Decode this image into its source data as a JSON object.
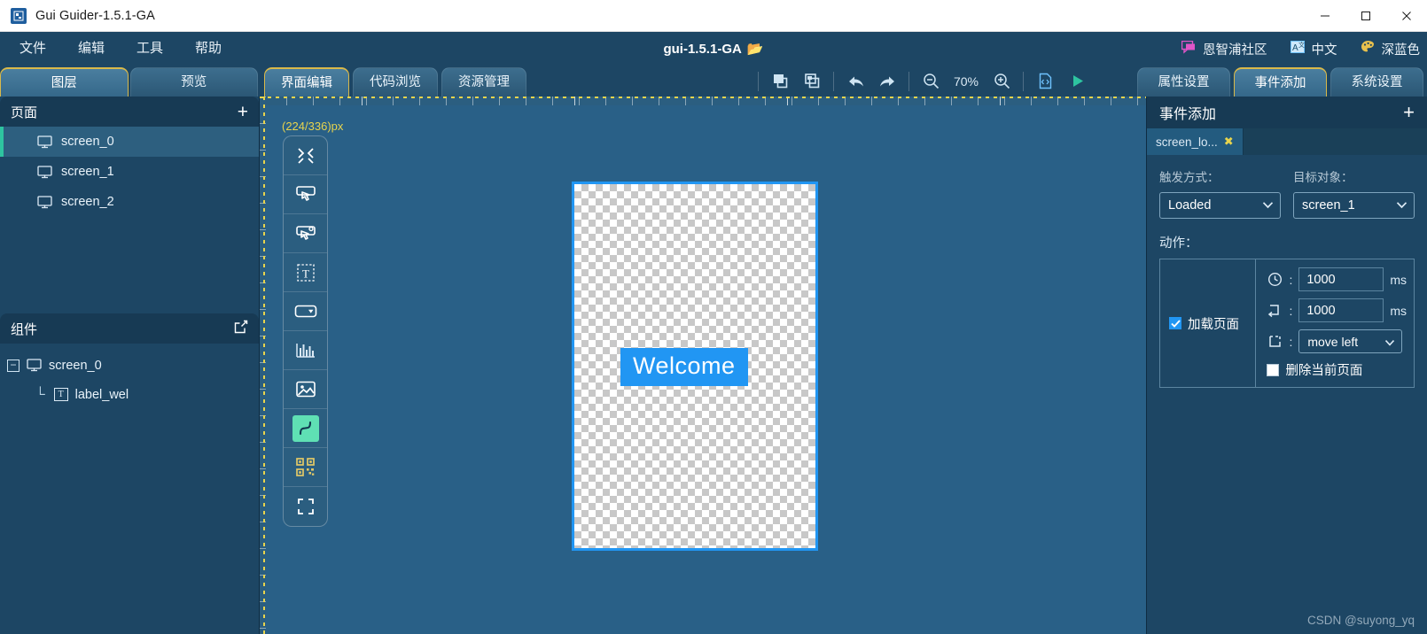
{
  "window": {
    "title": "Gui Guider-1.5.1-GA",
    "app_icon": "app-icon",
    "minimize": "minimize-icon",
    "maximize": "maximize-icon",
    "close": "close-icon"
  },
  "menubar": {
    "items": [
      {
        "label": "文件"
      },
      {
        "label": "编辑"
      },
      {
        "label": "工具"
      },
      {
        "label": "帮助"
      }
    ],
    "project_title": "gui-1.5.1-GA",
    "folder_icon": "folder-icon",
    "right_items": [
      {
        "label": "恩智浦社区",
        "icon": "comment-icon",
        "color": "#e056c8"
      },
      {
        "label": "中文",
        "icon": "translate-icon",
        "color": "#6fc3ff"
      },
      {
        "label": "深蓝色",
        "icon": "palette-icon",
        "color": "#e8c14d"
      }
    ]
  },
  "left_tabs": [
    {
      "label": "图层",
      "active": true
    },
    {
      "label": "预览",
      "active": false
    }
  ],
  "center_tabs": [
    {
      "label": "界面编辑",
      "active": true
    },
    {
      "label": "代码浏览",
      "active": false
    },
    {
      "label": "资源管理",
      "active": false
    }
  ],
  "right_tabs": [
    {
      "label": "属性设置",
      "active": false
    },
    {
      "label": "事件添加",
      "active": true
    },
    {
      "label": "系统设置",
      "active": false
    }
  ],
  "toolbar": {
    "copy_label": "copy-icon",
    "paste_label": "paste-icon",
    "undo_label": "undo-icon",
    "redo_label": "redo-icon",
    "zoom_out_label": "zoom-out-icon",
    "zoom_value": "70%",
    "zoom_in_label": "zoom-in-icon",
    "code_label": "code-file-icon",
    "run_label": "run-icon"
  },
  "pages_panel": {
    "title": "页面",
    "add_label": "+",
    "items": [
      {
        "label": "screen_0",
        "selected": true
      },
      {
        "label": "screen_1",
        "selected": false
      },
      {
        "label": "screen_2",
        "selected": false
      }
    ]
  },
  "components_panel": {
    "title": "组件",
    "expand_label": "external-link-icon",
    "items": [
      {
        "label": "screen_0",
        "level": 0
      },
      {
        "label": "label_wel",
        "level": 1
      }
    ]
  },
  "canvas": {
    "coord_label": "(224/336)px",
    "palette": [
      {
        "name": "collapse-icon"
      },
      {
        "name": "container-icon"
      },
      {
        "name": "widget-group-icon"
      },
      {
        "name": "text-icon"
      },
      {
        "name": "dropdown-icon"
      },
      {
        "name": "chart-icon"
      },
      {
        "name": "image-icon"
      },
      {
        "name": "curve-icon"
      },
      {
        "name": "qrcode-icon"
      },
      {
        "name": "expand-icon"
      }
    ],
    "welcome_label": "Welcome"
  },
  "event_panel": {
    "title": "事件添加",
    "add_label": "+",
    "chip_label": "screen_lo...",
    "chip_close": "close-circle-icon",
    "trigger_field_label": "触发方式：",
    "trigger_value": "Loaded",
    "target_field_label": "目标对象：",
    "target_value": "screen_1",
    "action_label": "动作：",
    "load_page_label": "加载页面",
    "load_page_checked": true,
    "delay_icon": "clock-icon",
    "delay_value": "1000",
    "delay_unit": "ms",
    "duration_icon": "duration-icon",
    "duration_value": "1000",
    "duration_unit": "ms",
    "transition_icon": "transition-icon",
    "transition_value": "move left",
    "delete_current_label": "删除当前页面",
    "delete_current_checked": false
  },
  "watermark": "CSDN @suyong_yq"
}
